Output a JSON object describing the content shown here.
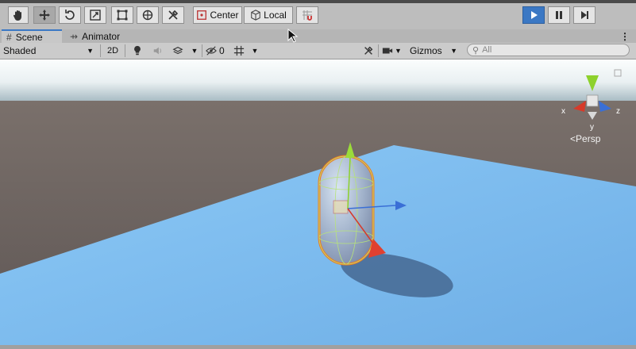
{
  "toolbar": {
    "tools": [
      {
        "name": "hand-tool",
        "icon": "hand-icon"
      },
      {
        "name": "move-tool",
        "icon": "move-arrows-icon",
        "selected": true
      },
      {
        "name": "rotate-tool",
        "icon": "rotate-icon"
      },
      {
        "name": "scale-tool",
        "icon": "scale-icon"
      },
      {
        "name": "rect-tool",
        "icon": "rect-transform-icon"
      },
      {
        "name": "transform-tool",
        "icon": "transform-icon"
      },
      {
        "name": "custom-tool",
        "icon": "tools-icon"
      }
    ],
    "pivot_label": "Center",
    "space_label": "Local",
    "snap_icon": "magnet-grid-icon",
    "play_icon": "play-icon",
    "pause_icon": "pause-icon",
    "step_icon": "step-icon",
    "accent": "#3b78c4"
  },
  "tabs": [
    {
      "label": "Scene",
      "icon": "grid-hash-icon",
      "active": true
    },
    {
      "label": "Animator",
      "icon": "animator-icon",
      "active": false
    }
  ],
  "scene_toolbar": {
    "shading_mode": "Shaded",
    "mode_2d": "2D",
    "hidden_count": "0",
    "gizmos_label": "Gizmos",
    "search_placeholder": "All"
  },
  "scene_gizmo": {
    "projection_label": "Persp",
    "axis_x": "x",
    "axis_z": "z",
    "axis_y": "y",
    "colors": {
      "x": "#d63a2a",
      "y": "#8dd12c",
      "z": "#3a6fd6"
    }
  },
  "scene": {
    "sky_color": "#eef3f5",
    "horizon_ground_color": "#6b6360",
    "plane_color": "#7dbcf0",
    "selection_outline": "#f07a1e"
  }
}
